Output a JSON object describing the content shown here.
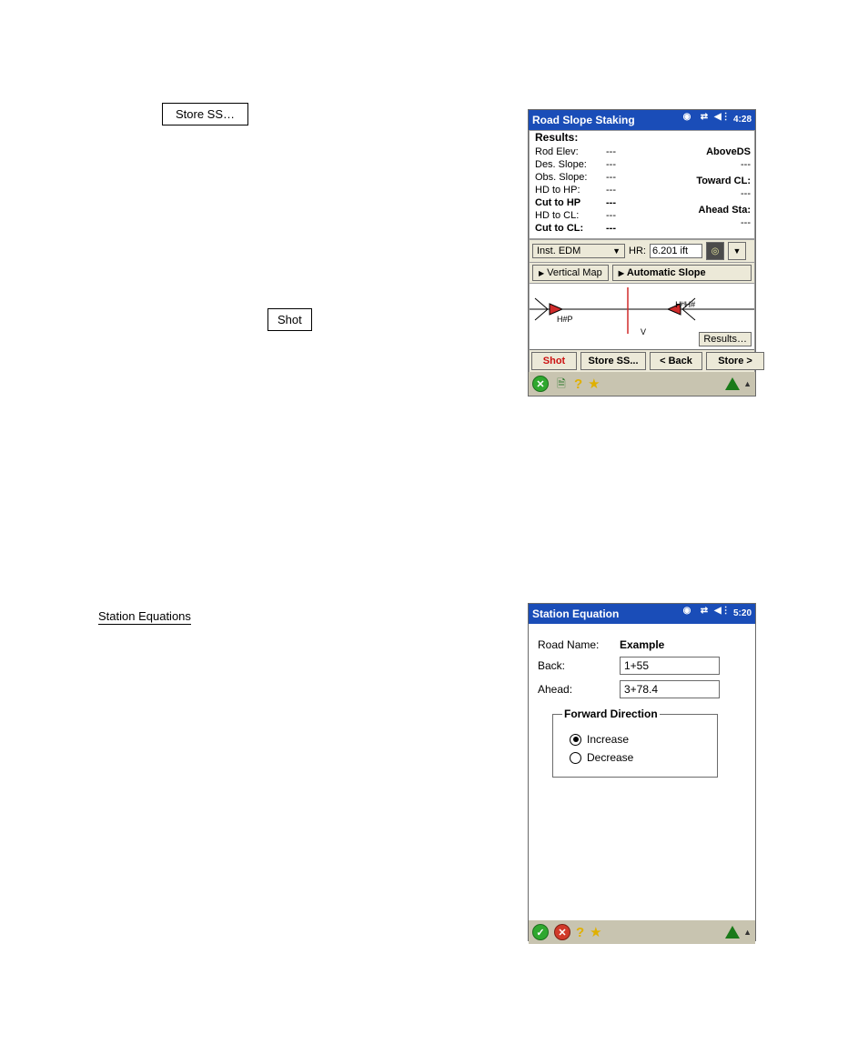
{
  "doc_buttons": {
    "store_ss": "Store SS…",
    "shot": "Shot"
  },
  "doc_heading_station_equations": "Station Equations",
  "win1": {
    "title": "Road Slope Staking",
    "clock": "4:28",
    "results_legend": "Results:",
    "rows_left": [
      {
        "label": "Rod Elev:",
        "value": "---",
        "bold": false
      },
      {
        "label": "Des. Slope:",
        "value": "---",
        "bold": false
      },
      {
        "label": "Obs. Slope:",
        "value": "---",
        "bold": false
      },
      {
        "label": "HD to HP:",
        "value": "---",
        "bold": false
      },
      {
        "label": "Cut to HP",
        "value": "---",
        "bold": true
      },
      {
        "label": "HD to CL:",
        "value": "---",
        "bold": false
      },
      {
        "label": "Cut to CL:",
        "value": "---",
        "bold": true
      }
    ],
    "right_fields": {
      "above_ds_label": "AboveDS",
      "above_ds_value": "---",
      "toward_cl_label": "Toward CL:",
      "toward_cl_value": "---",
      "ahead_sta_label": "Ahead Sta:",
      "ahead_sta_value": "---"
    },
    "inst_sel": "Inst. EDM",
    "hr_label": "HR:",
    "hr_value": "6.201 ift",
    "tab_vertical_map": "Vertical Map",
    "tab_auto_slope": "Automatic Slope",
    "map_labels": {
      "left": "H#P",
      "right": "ᕼᴴH#",
      "v": "V"
    },
    "results_btn": "Results…",
    "actions": {
      "shot": "Shot",
      "store_ss": "Store SS...",
      "back": "< Back",
      "store": "Store >"
    }
  },
  "win2": {
    "title": "Station Equation",
    "clock": "5:20",
    "road_name_label": "Road Name:",
    "road_name_value": "Example",
    "back_label": "Back:",
    "back_value": "1+55",
    "ahead_label": "Ahead:",
    "ahead_value": "3+78.4",
    "fwd_legend": "Forward Direction",
    "opt_increase": "Increase",
    "opt_decrease": "Decrease",
    "selected": "increase"
  },
  "glyphs": {
    "x": "✕",
    "check": "✓",
    "question": "?",
    "star": "★",
    "tri_down": "▼",
    "tri_right": "▶",
    "caret_up": "▲",
    "speaker": "◀⋮",
    "net": "⇄",
    "globe": "◉"
  }
}
